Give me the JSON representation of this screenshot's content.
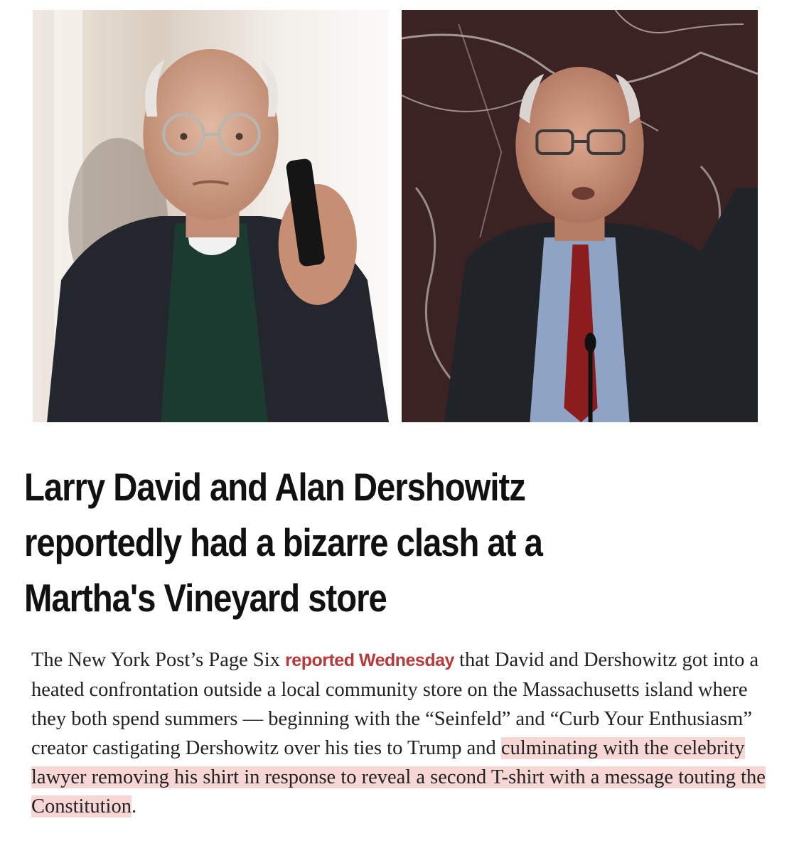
{
  "photos": {
    "left_alt": "Larry David on a phone call",
    "right_alt": "Alan Dershowitz speaking at a podium"
  },
  "article": {
    "headline": "Larry David and Alan Dershowitz reportedly had a bizarre clash at a Martha's Vineyard store",
    "body": {
      "part1": "The New York Post’s Page Six ",
      "link_text": "reported Wednesday",
      "part2": " that David and Dershowitz got into a heated confrontation outside a local community store on the Massachusetts island where they both spend summers — beginning with the “Seinfeld” and “Curb Your Enthusiasm” creator castigating Dershowitz over his ties to Trump and ",
      "highlighted": "culminating with the celebrity lawyer removing his shirt in response to reveal a second T-shirt with a message touting the Constitution",
      "end": "."
    }
  },
  "colors": {
    "link": "#b63a3a",
    "highlight": "#f7d6d6",
    "headline": "#111111",
    "body": "#222222"
  }
}
